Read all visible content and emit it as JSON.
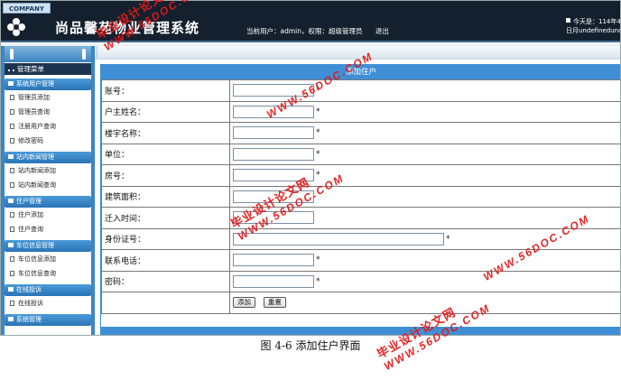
{
  "header": {
    "company_badge": "COMPANY",
    "system_title": "尚品馨苑物业管理系统",
    "current_user_label": "当前用户：admin，权限：超级管理员",
    "logout_label": "退出",
    "date_line1": "今天是：114年4",
    "date_line2": "日月undefinedunde"
  },
  "sidebar": {
    "menu_title": "管理菜单",
    "groups": [
      {
        "label": "系统用户管理",
        "items": [
          "管理员添加",
          "管理员查询",
          "注册用户查询",
          "修改密码"
        ]
      },
      {
        "label": "站内新闻管理",
        "items": [
          "站内新闻添加",
          "站内新闻查询"
        ]
      },
      {
        "label": "住户管理",
        "items": [
          "住户添加",
          "住户查询"
        ]
      },
      {
        "label": "车位信息管理",
        "items": [
          "车位信息添加",
          "车位信息查询"
        ]
      },
      {
        "label": "在线投诉",
        "items": [
          "在线投诉"
        ]
      },
      {
        "label": "系统管理",
        "items": []
      }
    ]
  },
  "form": {
    "title": "添加住户",
    "fields": [
      {
        "label": "账号：",
        "value": "",
        "required_mark": "*"
      },
      {
        "label": "户主姓名：",
        "value": "",
        "required_mark": "*"
      },
      {
        "label": "楼宇名称：",
        "value": "",
        "required_mark": "*"
      },
      {
        "label": "单位：",
        "value": "",
        "required_mark": "*"
      },
      {
        "label": "房号：",
        "value": "",
        "required_mark": "*"
      },
      {
        "label": "建筑面积：",
        "value": "",
        "required_mark": ""
      },
      {
        "label": "迁入时间：",
        "value": "",
        "required_mark": ""
      },
      {
        "label": "身份证号：",
        "value": "",
        "required_mark": "*"
      },
      {
        "label": "联系电话：",
        "value": "",
        "required_mark": "*"
      },
      {
        "label": "密码：",
        "value": "",
        "required_mark": "*"
      }
    ],
    "submit_label": "添加",
    "reset_label": "重置"
  },
  "caption": "图 4-6 添加住户界面",
  "watermark": {
    "cn": "毕业设计论文网",
    "en": "WWW.56DOC.COM",
    "color": "#e01a1a"
  }
}
